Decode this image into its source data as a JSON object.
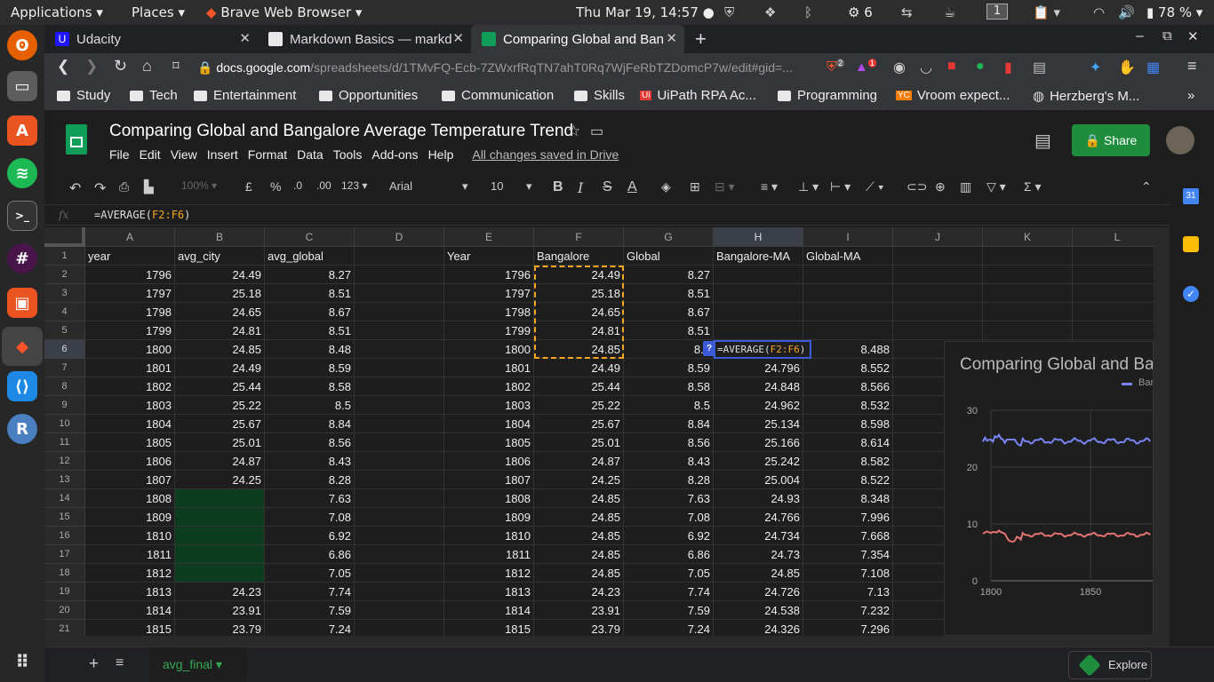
{
  "system_bar": {
    "applications": "Applications",
    "places": "Places",
    "browser": "Brave Web Browser",
    "datetime": "Thu Mar 19, 14:57",
    "settings_count": "6",
    "workspace": "1",
    "battery": "78 %"
  },
  "tabs": [
    {
      "title": "Udacity",
      "icon_color": "#2015ff"
    },
    {
      "title": "Markdown Basics — markd",
      "icon_color": "#e8e8e8"
    },
    {
      "title": "Comparing Global and Ban",
      "icon_color": "#0f9d58"
    }
  ],
  "address": {
    "domain": "docs.google.com",
    "path": "/spreadsheets/d/1TMvFQ-Ecb-7ZWxrfRqTN7ahT0Rq7WjFeRbTZDomcP7w/edit#gid=...",
    "brave_badge": "2",
    "rewards_badge": "1"
  },
  "bookmarks": [
    "Study",
    "Tech",
    "Entertainment",
    "Opportunities",
    "Communication",
    "Skills",
    "UiPath RPA Ac...",
    "Programming",
    "Vroom expect...",
    "Herzberg's M..."
  ],
  "sheet": {
    "title": "Comparing Global and Bangalore Average Temperature Trend",
    "menus": [
      "File",
      "Edit",
      "View",
      "Insert",
      "Format",
      "Data",
      "Tools",
      "Add-ons",
      "Help"
    ],
    "save_status": "All changes saved in Drive",
    "share": "Share"
  },
  "toolbar": {
    "zoom": "100%",
    "currency": "£",
    "percent": "%",
    "dec_less": ".0",
    "dec_more": ".00",
    "format": "123",
    "font": "Arial",
    "size": "10",
    "bold": "B",
    "italic": "I",
    "strike": "S",
    "textcolor": "A"
  },
  "formula": {
    "fx": "fx",
    "prefix": "=AVERAGE(",
    "ref": "F2:F6",
    "suffix": ")"
  },
  "grid": {
    "columns": [
      "A",
      "B",
      "C",
      "D",
      "E",
      "F",
      "G",
      "H",
      "I",
      "J",
      "K",
      "L"
    ],
    "headers": {
      "A": "year",
      "B": "avg_city",
      "C": "avg_global",
      "E": "Year",
      "F": "Bangalore",
      "G": "Global",
      "H": "Bangalore-MA",
      "I": "Global-MA"
    },
    "rows": [
      [
        "1796",
        "24.49",
        "8.27",
        "1796",
        "24.49",
        "8.27",
        "",
        ""
      ],
      [
        "1797",
        "25.18",
        "8.51",
        "1797",
        "25.18",
        "8.51",
        "",
        ""
      ],
      [
        "1798",
        "24.65",
        "8.67",
        "1798",
        "24.65",
        "8.67",
        "",
        ""
      ],
      [
        "1799",
        "24.81",
        "8.51",
        "1799",
        "24.81",
        "8.51",
        "",
        ""
      ],
      [
        "1800",
        "24.85",
        "8.48",
        "1800",
        "24.85",
        "8.4",
        "",
        "8.488"
      ],
      [
        "1801",
        "24.49",
        "8.59",
        "1801",
        "24.49",
        "8.59",
        "24.796",
        "8.552"
      ],
      [
        "1802",
        "25.44",
        "8.58",
        "1802",
        "25.44",
        "8.58",
        "24.848",
        "8.566"
      ],
      [
        "1803",
        "25.22",
        "8.5",
        "1803",
        "25.22",
        "8.5",
        "24.962",
        "8.532"
      ],
      [
        "1804",
        "25.67",
        "8.84",
        "1804",
        "25.67",
        "8.84",
        "25.134",
        "8.598"
      ],
      [
        "1805",
        "25.01",
        "8.56",
        "1805",
        "25.01",
        "8.56",
        "25.166",
        "8.614"
      ],
      [
        "1806",
        "24.87",
        "8.43",
        "1806",
        "24.87",
        "8.43",
        "25.242",
        "8.582"
      ],
      [
        "1807",
        "24.25",
        "8.28",
        "1807",
        "24.25",
        "8.28",
        "25.004",
        "8.522"
      ],
      [
        "1808",
        "",
        "7.63",
        "1808",
        "24.85",
        "7.63",
        "24.93",
        "8.348"
      ],
      [
        "1809",
        "",
        "7.08",
        "1809",
        "24.85",
        "7.08",
        "24.766",
        "7.996"
      ],
      [
        "1810",
        "",
        "6.92",
        "1810",
        "24.85",
        "6.92",
        "24.734",
        "7.668"
      ],
      [
        "1811",
        "",
        "6.86",
        "1811",
        "24.85",
        "6.86",
        "24.73",
        "7.354"
      ],
      [
        "1812",
        "",
        "7.05",
        "1812",
        "24.85",
        "7.05",
        "24.85",
        "7.108"
      ],
      [
        "1813",
        "24.23",
        "7.74",
        "1813",
        "24.23",
        "7.74",
        "24.726",
        "7.13"
      ],
      [
        "1814",
        "23.91",
        "7.59",
        "1814",
        "23.91",
        "7.59",
        "24.538",
        "7.232"
      ],
      [
        "1815",
        "23.79",
        "7.24",
        "1815",
        "23.79",
        "7.24",
        "24.326",
        "7.296"
      ]
    ],
    "empty_fill_color": "#0d3d1f",
    "copy_border_color": "#f5a623"
  },
  "tooltip_marker": "?",
  "chart": {
    "title": "Comparing Global and Ba",
    "legend_label": "Bar",
    "y_ticks": [
      "30",
      "20",
      "10",
      "0"
    ],
    "x_ticks": [
      "1800",
      "1850"
    ],
    "bangalore_color": "#7b84f5",
    "global_color": "#e57373"
  },
  "bottom": {
    "sheet_tab": "avg_final",
    "explore": "Explore"
  }
}
